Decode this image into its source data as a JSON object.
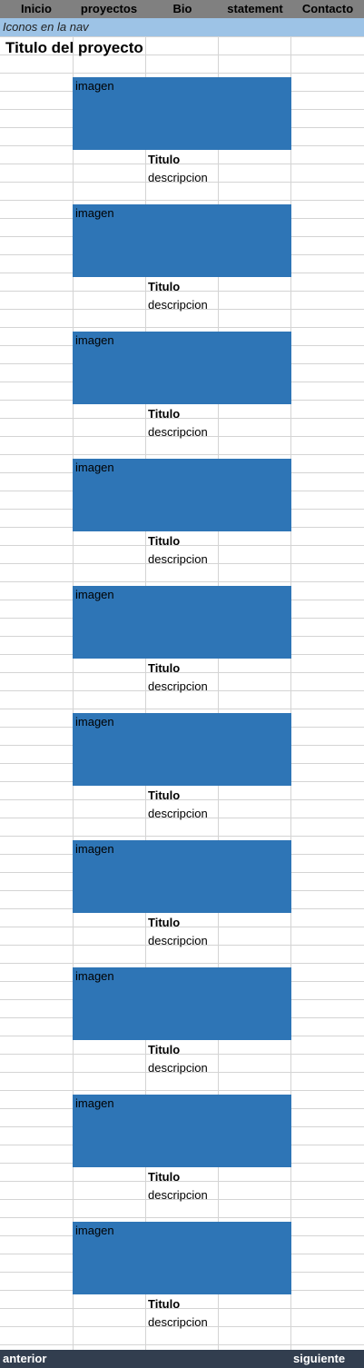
{
  "nav": {
    "items": [
      {
        "label": "Inicio"
      },
      {
        "label": "proyectos"
      },
      {
        "label": "Bio"
      },
      {
        "label": "statement"
      },
      {
        "label": "Contacto"
      }
    ]
  },
  "subnav": {
    "text": "Iconos en la nav"
  },
  "page_title": "Titulo del proyecto",
  "projects": [
    {
      "image_label": "imagen",
      "title": "Titulo",
      "description": "descripcion"
    },
    {
      "image_label": "imagen",
      "title": "Titulo",
      "description": "descripcion"
    },
    {
      "image_label": "imagen",
      "title": "Titulo",
      "description": "descripcion"
    },
    {
      "image_label": "imagen",
      "title": "Titulo",
      "description": "descripcion"
    },
    {
      "image_label": "imagen",
      "title": "Titulo",
      "description": "descripcion"
    },
    {
      "image_label": "imagen",
      "title": "Titulo",
      "description": "descripcion"
    },
    {
      "image_label": "imagen",
      "title": "Titulo",
      "description": "descripcion"
    },
    {
      "image_label": "imagen",
      "title": "Titulo",
      "description": "descripcion"
    },
    {
      "image_label": "imagen",
      "title": "Titulo",
      "description": "descripcion"
    },
    {
      "image_label": "imagen",
      "title": "Titulo",
      "description": "descripcion"
    }
  ],
  "footer": {
    "prev_label": "anterior",
    "next_label": "siguiente"
  },
  "colors": {
    "nav_bg": "#808080",
    "subnav_bg": "#9dc3e6",
    "image_placeholder": "#2e75b6",
    "footer_bg": "#323e4f",
    "gridline": "#d4d4d4"
  }
}
